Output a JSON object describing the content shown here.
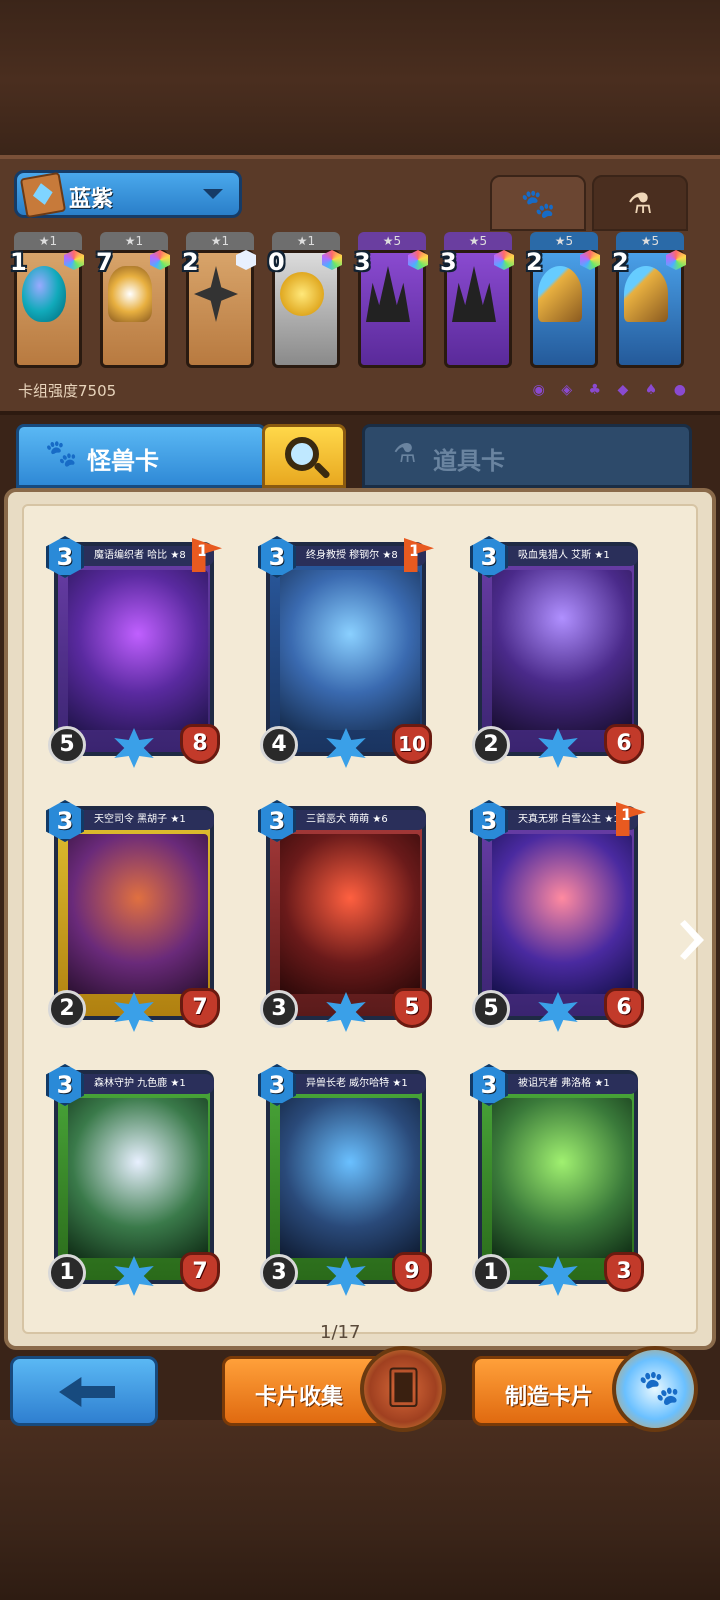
{
  "deck": {
    "name": "蓝紫",
    "power_label": "卡组强度7505",
    "tabs": [
      {
        "icon": "paw-icon",
        "glyph": "🐾"
      },
      {
        "icon": "potion-icon",
        "glyph": "⚗"
      }
    ],
    "cards": [
      {
        "stars": "★1",
        "cost": "1",
        "gem": "rainbow",
        "frame": "brown",
        "art": "egg-icon"
      },
      {
        "stars": "★1",
        "cost": "7",
        "gem": "rainbow",
        "frame": "brown",
        "art": "helmet-icon"
      },
      {
        "stars": "★1",
        "cost": "2",
        "gem": "white",
        "frame": "brown",
        "art": "shuriken-icon"
      },
      {
        "stars": "★1",
        "cost": "0",
        "gem": "rainbow",
        "frame": "gray",
        "art": "coin-icon"
      },
      {
        "stars": "★5",
        "cost": "3",
        "gem": "rainbow",
        "frame": "purple",
        "art": "spike-helm-icon"
      },
      {
        "stars": "★5",
        "cost": "3",
        "gem": "rainbow",
        "frame": "purple",
        "art": "spike-helm-icon"
      },
      {
        "stars": "★5",
        "cost": "2",
        "gem": "rainbow",
        "frame": "blue",
        "art": "orb-staff-icon"
      },
      {
        "stars": "★5",
        "cost": "2",
        "gem": "rainbow",
        "frame": "blue",
        "art": "orb-staff-icon"
      }
    ],
    "filter_icons": "◉ ◈ ♣ ◆ ♠ ●"
  },
  "tabs": {
    "monster_label": "怪兽卡",
    "item_label": "道具卡",
    "paw_glyph": "🐾",
    "flask_glyph": "⚗"
  },
  "cards": [
    {
      "title": "魔语编织者 哈比 ★8",
      "cost": "3",
      "flag": "1",
      "atk": "5",
      "hp": "8",
      "frame": "purple",
      "art": "a-1"
    },
    {
      "title": "终身教授 穆钢尔 ★8",
      "cost": "3",
      "flag": "1",
      "atk": "4",
      "hp": "10",
      "frame": "blue",
      "art": "a-2"
    },
    {
      "title": "吸血鬼猎人 艾斯 ★1",
      "cost": "3",
      "flag": "",
      "atk": "2",
      "hp": "6",
      "frame": "purple",
      "art": "a-3"
    },
    {
      "title": "天空司令 黑胡子 ★1",
      "cost": "3",
      "flag": "",
      "atk": "2",
      "hp": "7",
      "frame": "yellow",
      "art": "a-4"
    },
    {
      "title": "三首恶犬 萌萌 ★6",
      "cost": "3",
      "flag": "",
      "atk": "3",
      "hp": "5",
      "frame": "red",
      "art": "a-5"
    },
    {
      "title": "天真无邪 白雪公主 ★1",
      "cost": "3",
      "flag": "1",
      "atk": "5",
      "hp": "6",
      "frame": "purple",
      "art": "a-6"
    },
    {
      "title": "森林守护 九色鹿 ★1",
      "cost": "3",
      "flag": "",
      "atk": "1",
      "hp": "7",
      "frame": "green",
      "art": "a-7"
    },
    {
      "title": "异兽长老 威尔哈特 ★1",
      "cost": "3",
      "flag": "",
      "atk": "3",
      "hp": "9",
      "frame": "green",
      "art": "a-8"
    },
    {
      "title": "被诅咒者 弗洛格 ★1",
      "cost": "3",
      "flag": "",
      "atk": "1",
      "hp": "3",
      "frame": "green",
      "art": "a-9"
    }
  ],
  "pager": {
    "label": "1/17"
  },
  "buttons": {
    "back_icon": "back-arrow-icon",
    "collect_label": "卡片收集",
    "craft_label": "制造卡片",
    "collect_glyph": "🂠",
    "craft_glyph": "🐾"
  },
  "colors": {
    "accent_blue": "#2f89d6",
    "accent_orange": "#e06a10",
    "page_bg": "#f3ead6"
  }
}
